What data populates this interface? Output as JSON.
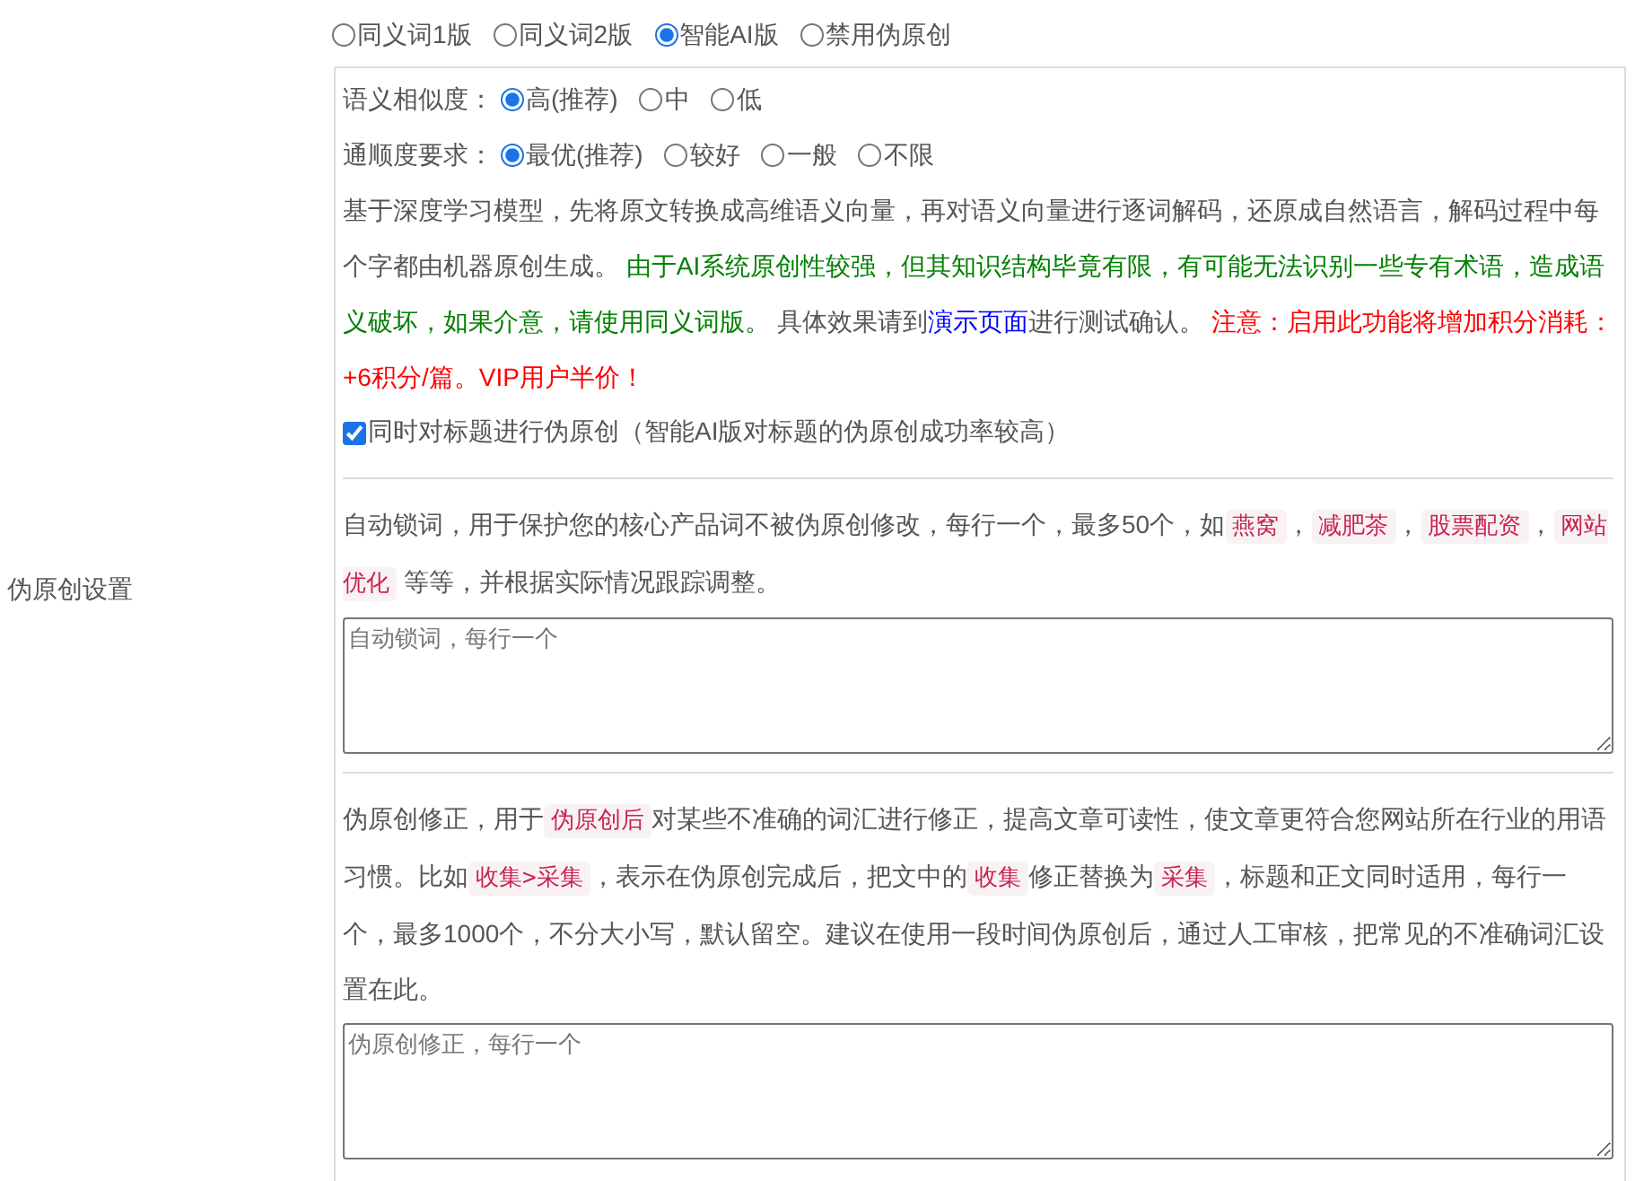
{
  "sidebar_label": "伪原创设置",
  "mode_options": [
    {
      "label": "同义词1版",
      "selected": false
    },
    {
      "label": "同义词2版",
      "selected": false
    },
    {
      "label": "智能AI版",
      "selected": true
    },
    {
      "label": "禁用伪原创",
      "selected": false
    }
  ],
  "similarity": {
    "label": "语义相似度：",
    "options": [
      {
        "label": "高(推荐)",
        "selected": true
      },
      {
        "label": "中",
        "selected": false
      },
      {
        "label": "低",
        "selected": false
      }
    ]
  },
  "fluency": {
    "label": "通顺度要求：",
    "options": [
      {
        "label": "最优(推荐)",
        "selected": true
      },
      {
        "label": "较好",
        "selected": false
      },
      {
        "label": "一般",
        "selected": false
      },
      {
        "label": "不限",
        "selected": false
      }
    ]
  },
  "ai_description": [
    {
      "kind": "text",
      "text": "基于深度学习模型，先将原文转换成高维语义向量，再对语义向量进行逐词解码，还原成自然语言，解码过程中每个字都由机器原创生成。 "
    },
    {
      "kind": "note",
      "text": "由于AI系统原创性较强，但其知识结构毕竟有限，有可能无法识别一些专有术语，造成语义破坏，如果介意，请使用同义词版。"
    },
    {
      "kind": "text",
      "text": " 具体效果请到"
    },
    {
      "kind": "link",
      "text": "演示页面"
    },
    {
      "kind": "text",
      "text": "进行测试确认。 "
    },
    {
      "kind": "warning",
      "text": "注意：启用此功能将增加积分消耗：+6积分/篇。VIP用户半价！"
    }
  ],
  "title_checkbox": {
    "label": "同时对标题进行伪原创（智能AI版对标题的伪原创成功率较高）",
    "checked": true
  },
  "lock_words": {
    "description": [
      {
        "kind": "text",
        "text": "自动锁词，用于保护您的核心产品词不被伪原创修改，每行一个，最多50个，如"
      },
      {
        "kind": "code",
        "text": "燕窝"
      },
      {
        "kind": "text",
        "text": "，"
      },
      {
        "kind": "code",
        "text": "减肥茶"
      },
      {
        "kind": "text",
        "text": "，"
      },
      {
        "kind": "code",
        "text": "股票配资"
      },
      {
        "kind": "text",
        "text": "，"
      },
      {
        "kind": "code",
        "text": "网站优化"
      },
      {
        "kind": "text",
        "text": " 等等，并根据实际情况跟踪调整。"
      }
    ],
    "placeholder": "自动锁词，每行一个"
  },
  "corrections": {
    "description": [
      {
        "kind": "text",
        "text": "伪原创修正，用于"
      },
      {
        "kind": "code",
        "text": "伪原创后"
      },
      {
        "kind": "text",
        "text": "对某些不准确的词汇进行修正，提高文章可读性，使文章更符合您网站所在行业的用语习惯。比如"
      },
      {
        "kind": "code",
        "text": "收集>采集"
      },
      {
        "kind": "text",
        "text": "，表示在伪原创完成后，把文中的"
      },
      {
        "kind": "code",
        "text": "收集"
      },
      {
        "kind": "text",
        "text": "修正替换为"
      },
      {
        "kind": "code",
        "text": "采集"
      },
      {
        "kind": "text",
        "text": "，标题和正文同时适用，每行一个，最多1000个，不分大小写，默认留空。建议在使用一段时间伪原创后，通过人工审核，把常见的不准确词汇设置在此。"
      }
    ],
    "placeholder": "伪原创修正，每行一个"
  }
}
